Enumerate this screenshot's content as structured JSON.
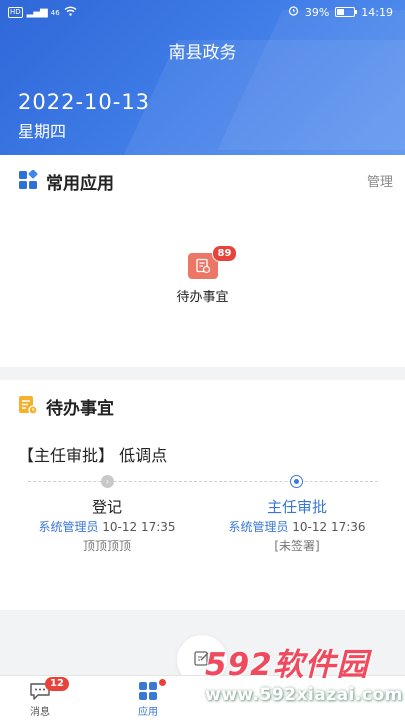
{
  "status_bar": {
    "left": [
      "HD",
      "46",
      "wifi"
    ],
    "battery": "39%",
    "time": "14:19"
  },
  "header": {
    "title": "南县政务",
    "date": "2022-10-13",
    "weekday": "星期四"
  },
  "common_apps": {
    "title": "常用应用",
    "manage_label": "管理",
    "apps": [
      {
        "label": "待办事宜",
        "badge": "89",
        "icon": "todo-doc-icon",
        "color": "#ec7766"
      }
    ]
  },
  "todo": {
    "title": "待办事宜",
    "item_title": "【主任审批】 低调点",
    "steps": [
      {
        "name": "登记",
        "operator": "系统管理员",
        "time": "10-12 17:35",
        "note": "顶顶顶顶",
        "state": "done"
      },
      {
        "name": "主任审批",
        "operator": "系统管理员",
        "time": "10-12 17:36",
        "note": "[未签署]",
        "state": "current"
      }
    ]
  },
  "tabbar": {
    "tabs": [
      {
        "label": "消息",
        "badge": "12",
        "icon": "message-icon"
      },
      {
        "label": "应用",
        "icon": "apps-grid-icon",
        "active": true
      }
    ]
  },
  "watermark": {
    "brand": "592软件园",
    "url": "www.592xiazai.com"
  },
  "colors": {
    "primary": "#3a78d6",
    "header_gradient_start": "#2f67d8",
    "badge_red": "#e8433a",
    "todo_icon_bg": "#ec7766",
    "section_icon_orange": "#f5b12d"
  }
}
